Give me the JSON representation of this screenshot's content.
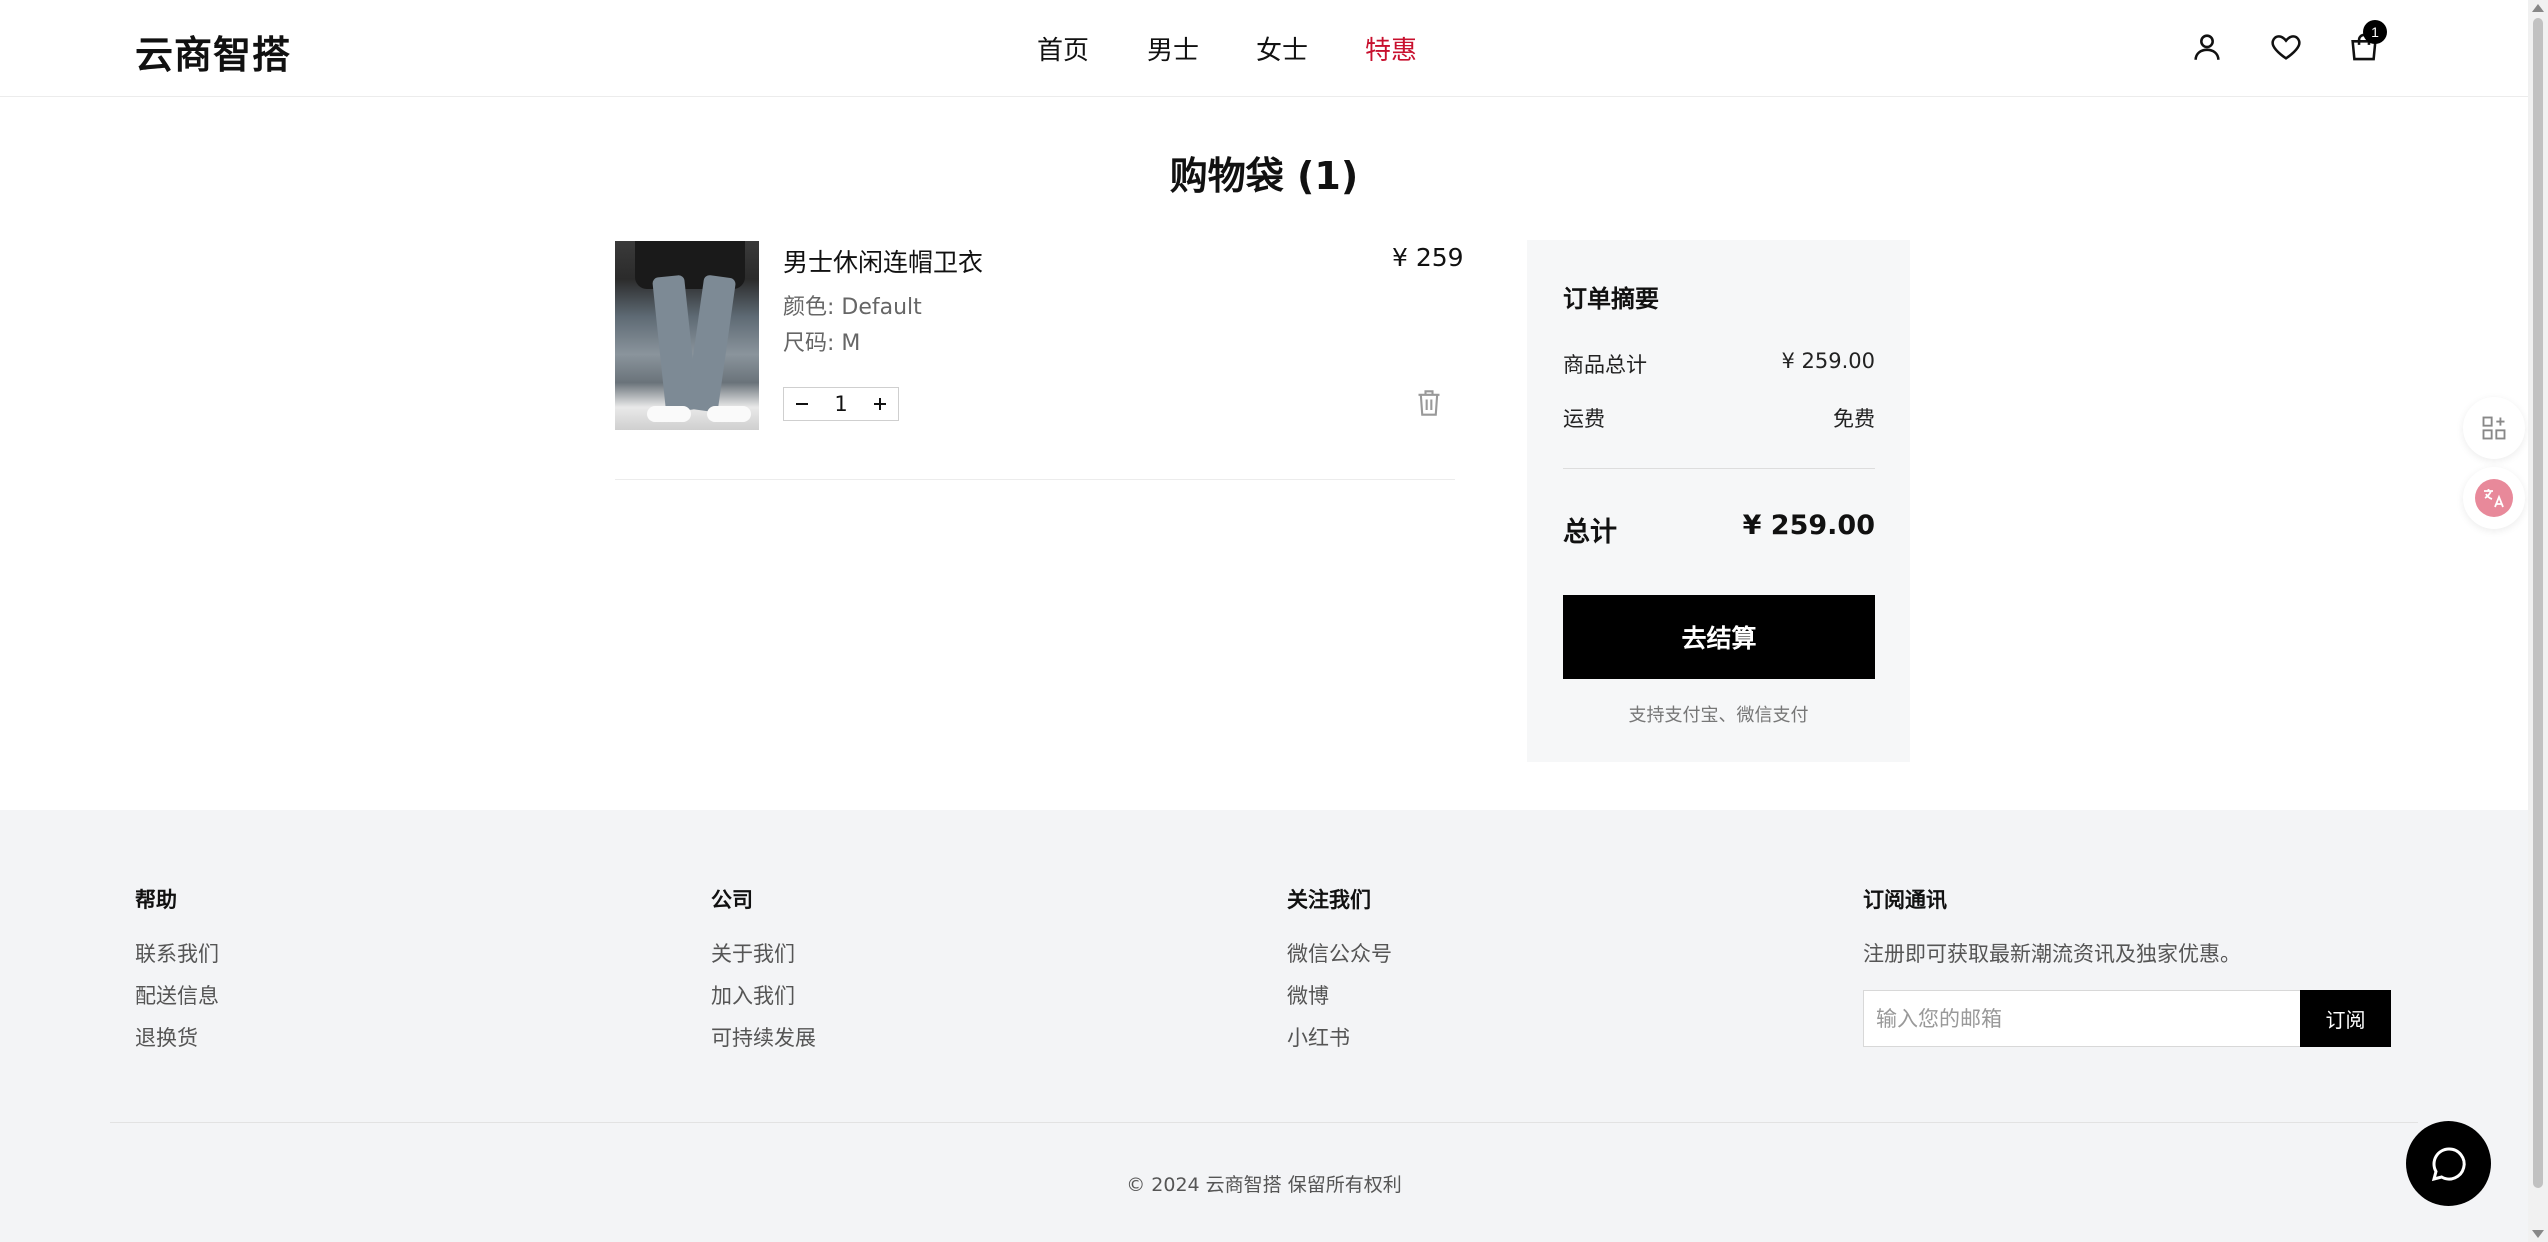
{
  "header": {
    "logo": "云商智搭",
    "nav": [
      "首页",
      "男士",
      "女士",
      "特惠"
    ],
    "cart_count": "1",
    "icons": [
      "user-icon",
      "heart-icon",
      "shopping-bag-icon"
    ],
    "sale_color": "#c8102e"
  },
  "cart": {
    "title": "购物袋 (1)",
    "item": {
      "name": "男士休闲连帽卫衣",
      "price": "¥ 259",
      "color": "颜色: Default",
      "size": "尺码: M",
      "quantity": "1"
    }
  },
  "summary": {
    "title": "订单摘要",
    "subtotal_label": "商品总计",
    "subtotal_value": "¥ 259.00",
    "shipping_label": "运费",
    "shipping_value": "免费",
    "total_label": "总计",
    "total_value": "¥ 259.00",
    "checkout_label": "去结算",
    "payment_note": "支持支付宝、微信支付"
  },
  "footer": {
    "help": {
      "title": "帮助",
      "links": [
        "联系我们",
        "配送信息",
        "退换货"
      ]
    },
    "company": {
      "title": "公司",
      "links": [
        "关于我们",
        "加入我们",
        "可持续发展"
      ]
    },
    "follow": {
      "title": "关注我们",
      "links": [
        "微信公众号",
        "微博",
        "小红书"
      ]
    },
    "newsletter": {
      "title": "订阅通讯",
      "desc": "注册即可获取最新潮流资讯及独家优惠。",
      "placeholder": "输入您的邮箱",
      "button": "订阅"
    },
    "copyright": "© 2024 云商智搭 保留所有权利"
  }
}
